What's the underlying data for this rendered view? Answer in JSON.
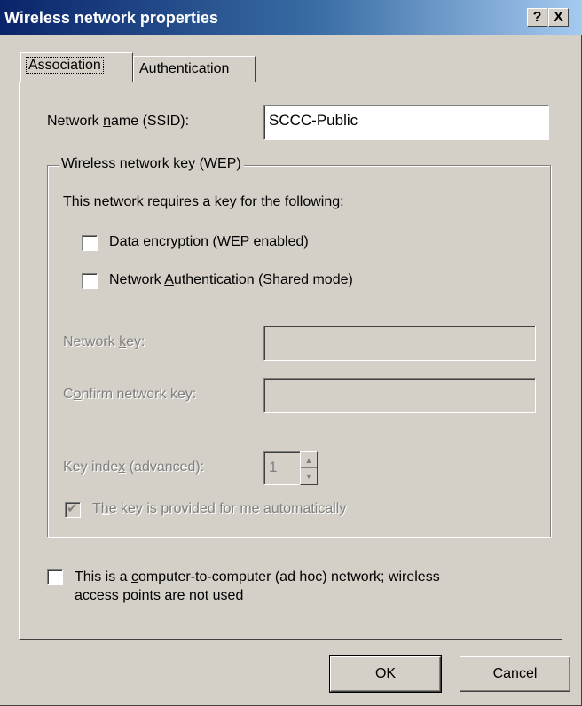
{
  "window": {
    "title": "Wireless network properties",
    "help_glyph": "?",
    "close_glyph": "X"
  },
  "tabs": [
    {
      "label": "Association",
      "active": true
    },
    {
      "label": "Authentication",
      "active": false
    }
  ],
  "ssid": {
    "label_pre": "Network ",
    "label_key": "n",
    "label_post": "ame (SSID):",
    "value": "SCCC-Public"
  },
  "wep_group": {
    "title": "Wireless network key (WEP)",
    "intro": "This network requires a key for the following:",
    "data_encryption": {
      "key": "D",
      "rest": "ata encryption (WEP enabled)",
      "checked": false
    },
    "network_auth": {
      "pre": "Network ",
      "key": "A",
      "rest": "uthentication (Shared mode)",
      "checked": false
    },
    "network_key": {
      "pre": "Network ",
      "key": "k",
      "rest": "ey:",
      "value": ""
    },
    "confirm_key": {
      "pre": "C",
      "key": "o",
      "rest": "nfirm network key:",
      "value": ""
    },
    "key_index": {
      "pre": "Key inde",
      "key": "x",
      "rest": " (advanced):",
      "value": "1"
    },
    "auto_key": {
      "pre": "T",
      "key": "h",
      "rest": "e key is provided for me automatically",
      "checked": true
    }
  },
  "adhoc": {
    "line1_pre": "This is a ",
    "line1_key": "c",
    "line1_rest": "omputer-to-computer (ad hoc) network; wireless",
    "line2": "access points are not used",
    "checked": false
  },
  "buttons": {
    "ok": "OK",
    "cancel": "Cancel"
  }
}
